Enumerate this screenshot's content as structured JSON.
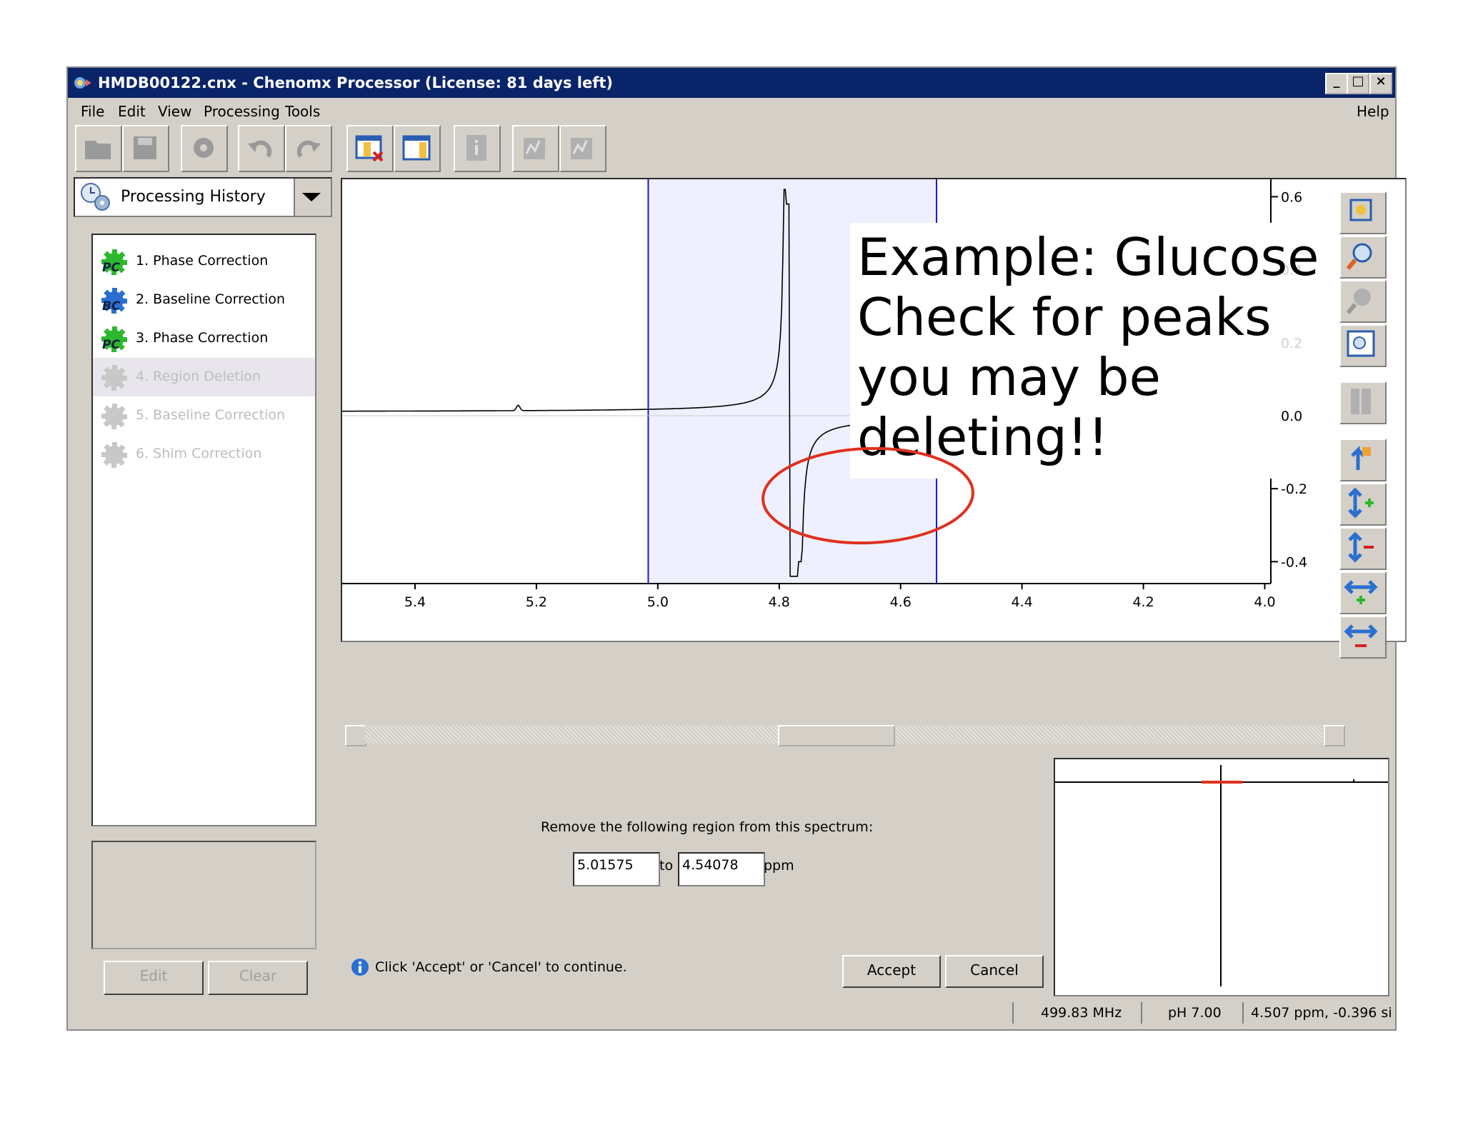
{
  "window": {
    "title": "HMDB00122.cnx - Chenomx Processor (License: 81 days left)",
    "controls": [
      "_",
      "□",
      "×"
    ]
  },
  "menu": {
    "items": [
      "File",
      "Edit",
      "View",
      "Processing",
      "Tools"
    ],
    "help": "Help"
  },
  "toolbar": {
    "icons": [
      "open-icon",
      "save-icon",
      "process-icon",
      "undo-icon",
      "redo-icon",
      "remove-region-icon",
      "split-view-icon",
      "info-icon",
      "add-spectrum-icon",
      "export-spectrum-icon"
    ]
  },
  "history": {
    "selector_label": "Processing History",
    "items": [
      {
        "label": "1.  Phase Correction",
        "badge": "PC",
        "color": "#2db82d",
        "state": "active"
      },
      {
        "label": "2.  Baseline Correction",
        "badge": "BC",
        "color": "#2a6fd1",
        "state": "active"
      },
      {
        "label": "3.  Phase Correction",
        "badge": "PC",
        "color": "#2db82d",
        "state": "active"
      },
      {
        "label": "4.  Region Deletion",
        "badge": "",
        "color": "#c8c8c8",
        "state": "selected-disabled"
      },
      {
        "label": "5.  Baseline Correction",
        "badge": "",
        "color": "#c8c8c8",
        "state": "disabled"
      },
      {
        "label": "6.  Shim Correction",
        "badge": "",
        "color": "#c8c8c8",
        "state": "disabled"
      }
    ],
    "edit_label": "Edit",
    "clear_label": "Clear"
  },
  "chart_data": {
    "type": "line",
    "xlabel": "",
    "ylabel": "",
    "x_ticks": [
      "5.4",
      "5.2",
      "5.0",
      "4.8",
      "4.6",
      "4.4",
      "4.2",
      "4.0"
    ],
    "y_ticks": [
      "0.6",
      "0.4",
      "0.2",
      "0.0",
      "-0.2",
      "-0.4"
    ],
    "xlim": [
      5.52,
      3.99
    ],
    "ylim": [
      -0.46,
      0.64
    ],
    "x_reversed": true,
    "selected_region": [
      5.01575,
      4.54078
    ],
    "accent_color": "#1a1acc",
    "region_fill": "#eef0ff"
  },
  "annotation": {
    "lines": [
      "Example: Glucose",
      "Check for peaks",
      "you may be",
      "deleting!!"
    ],
    "circle_color": "#e0301e"
  },
  "region_dialog": {
    "prompt": "Remove the following region from this spectrum:",
    "from_value": "5.01575",
    "to_label": "to",
    "to_value": "4.54078",
    "unit": "ppm",
    "hint": "Click 'Accept' or 'Cancel' to continue.",
    "accept_label": "Accept",
    "cancel_label": "Cancel"
  },
  "status": {
    "frequency": "499.83 MHz",
    "ph": "pH 7.00",
    "cursor": "4.507 ppm, -0.396 si"
  }
}
